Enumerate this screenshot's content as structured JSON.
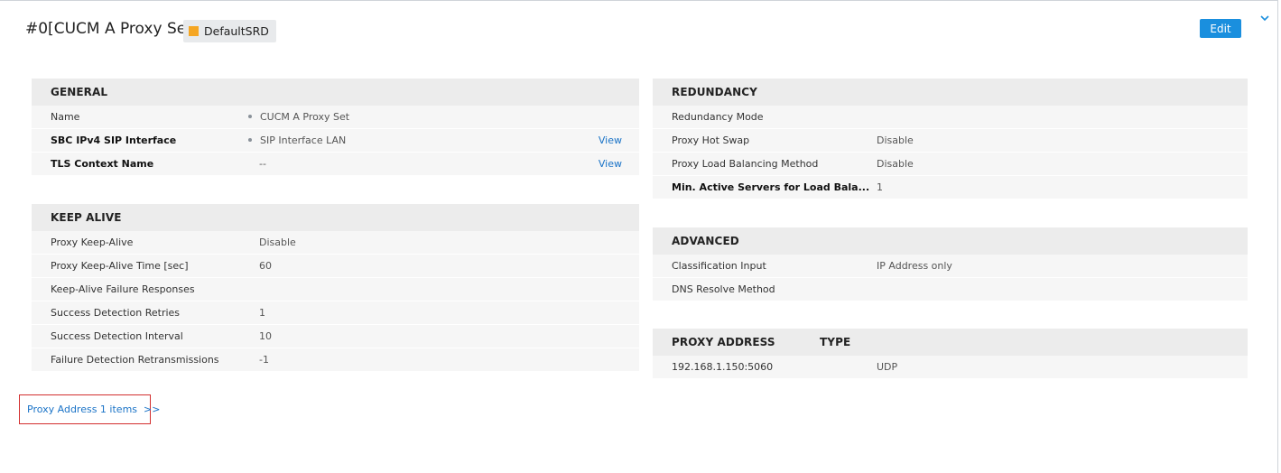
{
  "header": {
    "title": "#0[CUCM A Proxy Set]",
    "srd_badge": "DefaultSRD",
    "srd_color": "#f5a623",
    "edit_label": "Edit",
    "collapse_icon": "chevron-down-icon"
  },
  "general": {
    "title": "GENERAL",
    "rows": [
      {
        "label": "Name",
        "value": "CUCM A Proxy Set",
        "link": ""
      },
      {
        "label": "SBC IPv4 SIP Interface",
        "value": "SIP Interface LAN",
        "link": "View"
      },
      {
        "label": "TLS Context Name",
        "value": "--",
        "link": "View"
      }
    ]
  },
  "keep_alive": {
    "title": "KEEP ALIVE",
    "rows": [
      {
        "label": "Proxy Keep-Alive",
        "value": "Disable"
      },
      {
        "label": "Proxy Keep-Alive Time [sec]",
        "value": "60"
      },
      {
        "label": "Keep-Alive Failure Responses",
        "value": ""
      },
      {
        "label": "Success Detection Retries",
        "value": "1"
      },
      {
        "label": "Success Detection Interval",
        "value": "10"
      },
      {
        "label": "Failure Detection Retransmissions",
        "value": "-1"
      }
    ]
  },
  "redundancy": {
    "title": "REDUNDANCY",
    "rows": [
      {
        "label": "Redundancy Mode",
        "value": ""
      },
      {
        "label": "Proxy Hot Swap",
        "value": "Disable"
      },
      {
        "label": "Proxy Load Balancing Method",
        "value": "Disable"
      },
      {
        "label": "Min. Active Servers for Load Bala...",
        "value": "1"
      }
    ]
  },
  "advanced": {
    "title": "ADVANCED",
    "rows": [
      {
        "label": "Classification Input",
        "value": "IP Address only"
      },
      {
        "label": "DNS Resolve Method",
        "value": ""
      }
    ]
  },
  "proxy_table": {
    "columns": [
      "PROXY ADDRESS",
      "TYPE"
    ],
    "rows": [
      {
        "address": "192.168.1.150:5060",
        "type": "UDP"
      }
    ]
  },
  "footer": {
    "proxy_link": "Proxy Address 1 items  >>"
  }
}
